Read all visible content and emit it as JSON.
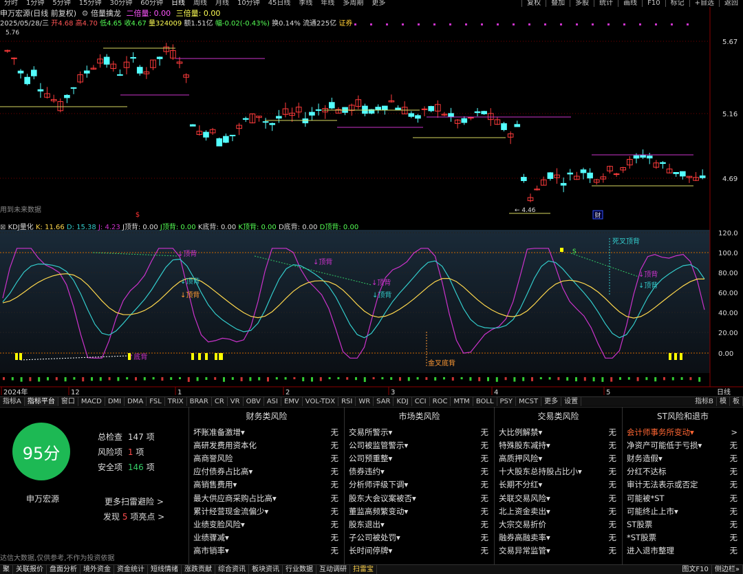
{
  "period_bar": {
    "items": [
      "分时",
      "1分钟",
      "5分钟",
      "15分钟",
      "30分钟",
      "60分钟",
      "日线",
      "周线",
      "月线",
      "10分钟",
      "45日线",
      "季线",
      "年线",
      "多周期",
      "更多"
    ],
    "active_index": 6,
    "right_items": [
      "复权",
      "叠加",
      "多股",
      "统计",
      "画线",
      "F10",
      "标记",
      "+自选",
      "返回"
    ]
  },
  "header": {
    "stock_title": "申万宏源(日线 前复权)",
    "indicator_name": "倍量擒龙",
    "double_vol_label": "二倍量: 0.00",
    "triple_vol_label": "三倍量: 0.00",
    "date": "2025/05/28/三",
    "open": "开4.68",
    "high": "高4.70",
    "low": "低4.65",
    "close": "收4.67",
    "volume": "量324009",
    "amount": "额1.51亿",
    "change": "幅-0.02(-0.43%)",
    "turnover": "换0.14%",
    "float_cap": "流通225亿",
    "tag": "证券"
  },
  "main_chart": {
    "price_labels": [
      "5.67",
      "5.16",
      "4.69"
    ],
    "high_marker": "5.76",
    "low_marker": "4.46",
    "future_data_text": "用到未来数据",
    "caifu_marker": "财",
    "dollar_marker": "$"
  },
  "kdj": {
    "title": "KDJ量化",
    "k": "K: 11.66",
    "d": "D: 15.38",
    "j": "J: 4.23",
    "j_top": "J顶背: 0.00",
    "j_top2": "J顶背: 0.00",
    "k_bottom": "K底背: 0.00",
    "k_top": "K顶背: 0.00",
    "d_bottom": "D底背: 0.00",
    "d_top": "D顶背: 0.00",
    "y_labels": [
      "120.0",
      "100.0",
      "80.00",
      "60.00",
      "40.00",
      "20.00",
      "0.00"
    ],
    "annotations": {
      "ding_bei": "顶背",
      "di_bei": "底背",
      "jin_cha_di_bei": "金叉底背",
      "si_cha_ding_bei": "死叉顶背",
      "s": "S"
    }
  },
  "x_axis": {
    "labels": [
      "2024年",
      "12",
      "1",
      "2",
      "3",
      "4",
      "5"
    ],
    "right_label": "日线"
  },
  "tabs": {
    "items": [
      "指标A",
      "指标平台",
      "窗口",
      "MACD",
      "DMI",
      "DMA",
      "FSL",
      "TRIX",
      "BRAR",
      "CR",
      "VR",
      "OBV",
      "ASI",
      "EMV",
      "VOL-TDX",
      "RSI",
      "WR",
      "SAR",
      "KDJ",
      "CCI",
      "ROC",
      "MTM",
      "BOLL",
      "PSY",
      "MCST",
      "更多",
      "设置"
    ],
    "active_index": 1,
    "right_items": [
      "指标B",
      "模",
      "板"
    ]
  },
  "risk_panel": {
    "score": "95分",
    "stock_name": "申万宏源",
    "total_label": "总检查",
    "total_value": "147",
    "total_unit": "项",
    "risk_label": "风险项",
    "risk_value": "1",
    "risk_unit": "项",
    "safe_label": "安全项",
    "safe_value": "146",
    "safe_unit": "项",
    "more_link": "更多扫雷避险 >",
    "found_prefix": "发现",
    "found_value": "5",
    "found_suffix": "项亮点 >",
    "disclaimer": "达信大数据,仅供参考,不作为投资依据",
    "columns": [
      {
        "title": "财务类风险",
        "rows": [
          [
            "坏账准备激增▾",
            "无"
          ],
          [
            "高研发费用资本化",
            "无"
          ],
          [
            "高商誉风险",
            "无"
          ],
          [
            "应付债券占比高▾",
            "无"
          ],
          [
            "高销售费用▾",
            "无"
          ],
          [
            "最大供应商采购占比高▾",
            "无"
          ],
          [
            "累计经营现金流偏少▾",
            "无"
          ],
          [
            "业绩变脸风险▾",
            "无"
          ],
          [
            "业绩骤减▾",
            "无"
          ],
          [
            "高市销率▾",
            "无"
          ]
        ]
      },
      {
        "title": "市场类风险",
        "rows": [
          [
            "交易所警示▾",
            "无"
          ],
          [
            "公司被监管警示▾",
            "无"
          ],
          [
            "公司预重整▾",
            "无"
          ],
          [
            "债券违约▾",
            "无"
          ],
          [
            "分析师评级下调▾",
            "无"
          ],
          [
            "股东大会议案被否▾",
            "无"
          ],
          [
            "董监高频繁变动▾",
            "无"
          ],
          [
            "股东退出▾",
            "无"
          ],
          [
            "子公司被处罚▾",
            "无"
          ],
          [
            "长时间停牌▾",
            "无"
          ]
        ]
      },
      {
        "title": "交易类风险",
        "rows": [
          [
            "大比例解禁▾",
            "无"
          ],
          [
            "特殊股东减持▾",
            "无"
          ],
          [
            "高质押风险▾",
            "无"
          ],
          [
            "十大股东总持股占比小▾",
            "无"
          ],
          [
            "长期不分红▾",
            "无"
          ],
          [
            "关联交易风险▾",
            "无"
          ],
          [
            "北上资金卖出▾",
            "无"
          ],
          [
            "大宗交易折价",
            "无"
          ],
          [
            "融券高融卖率▾",
            "无"
          ],
          [
            "交易异常监管▾",
            "无"
          ]
        ]
      },
      {
        "title": "ST风险和退市",
        "rows": [
          [
            "会计师事务所变动▾",
            ">"
          ],
          [
            "净资产可能低于亏损▾",
            "无"
          ],
          [
            "财务造假▾",
            "无"
          ],
          [
            "分红不达标",
            "无"
          ],
          [
            "审计无法表示或否定",
            "无"
          ],
          [
            "可能被*ST",
            "无"
          ],
          [
            "可能终止上市▾",
            "无"
          ],
          [
            "ST股票",
            "无"
          ],
          [
            "*ST股票",
            "无"
          ],
          [
            "进入退市整理",
            "无"
          ]
        ]
      }
    ]
  },
  "footer": {
    "items": [
      "聚",
      "关联报价",
      "盘面分析",
      "境外资金",
      "资金统计",
      "短线情绪",
      "涨跌贡献",
      "综合资讯",
      "板块资讯",
      "行业数据",
      "互动调研",
      "扫雷宝"
    ],
    "active_index": 11,
    "right_items": [
      "图文F10",
      "侧边栏»"
    ]
  },
  "colors": {
    "up": "#ff3b3b",
    "down": "#54ffff",
    "k_line": "#ffd84d",
    "d_line": "#33cccc",
    "j_line": "#cc33cc",
    "score_bg": "#1db954",
    "risk_red": "#ff4d4d",
    "safe_green": "#33cc66",
    "highlight_orange": "#ff6633"
  }
}
